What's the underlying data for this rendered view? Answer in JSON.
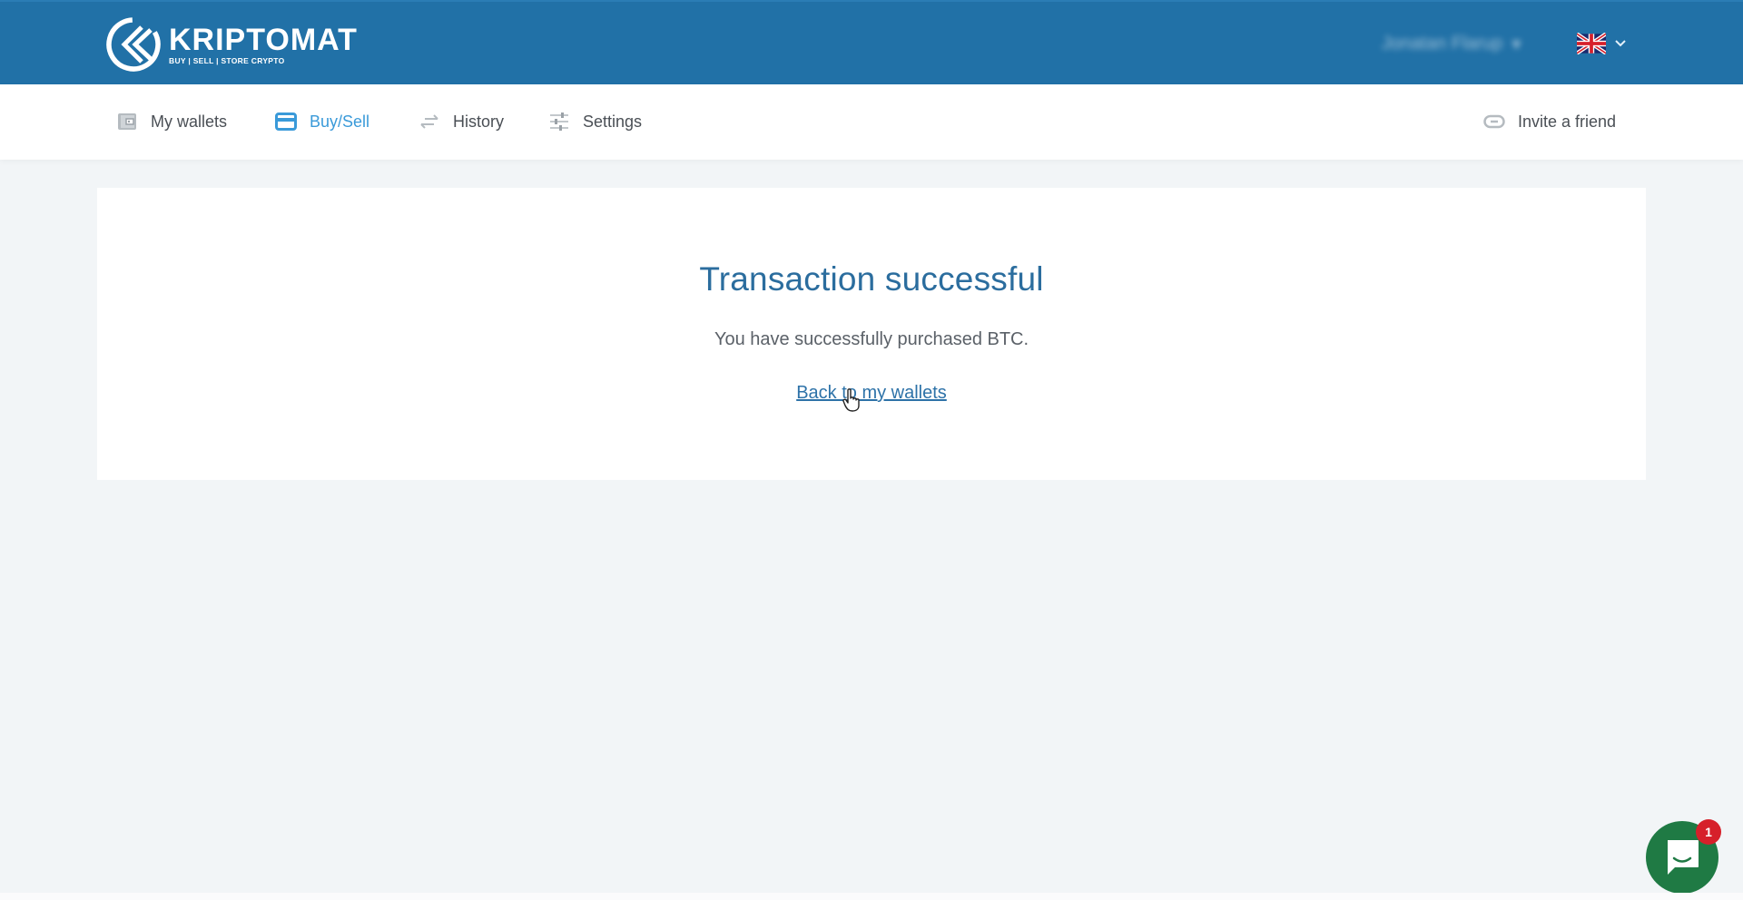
{
  "header": {
    "brand_name": "KRIPTOMAT",
    "brand_tagline": "BUY | SELL | STORE CRYPTO",
    "user_name": "Jonatan Flarup",
    "user_chevron": "▾",
    "language": "English (UK)",
    "language_chevron": "⌄",
    "colors": {
      "brand_blue": "#2171a7"
    }
  },
  "nav": {
    "items": [
      {
        "label": "My wallets",
        "icon": "wallet-icon",
        "active": false
      },
      {
        "label": "Buy/Sell",
        "icon": "card-icon",
        "active": true
      },
      {
        "label": "History",
        "icon": "swap-arrows-icon",
        "active": false
      },
      {
        "label": "Settings",
        "icon": "sliders-icon",
        "active": false
      }
    ],
    "invite": {
      "label": "Invite a friend",
      "icon": "link-icon"
    },
    "colors": {
      "active": "#3a9ad9",
      "inactive": "#4a4f55"
    }
  },
  "result": {
    "title": "Transaction successful",
    "message": "You have successfully purchased BTC.",
    "back_link": "Back to my wallets"
  },
  "chat": {
    "unread_count": "1",
    "colors": {
      "button": "#1f7a44",
      "badge": "#d6202a"
    }
  }
}
